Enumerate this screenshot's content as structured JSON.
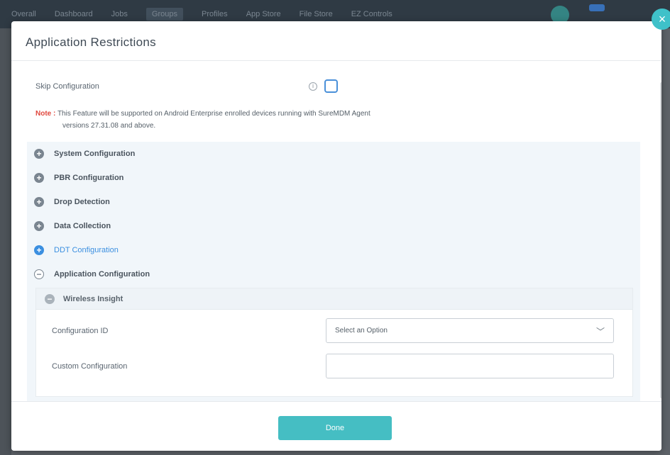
{
  "topnav": {
    "items": [
      "Overall",
      "Dashboard",
      "Jobs",
      "Groups",
      "Profiles",
      "App Store",
      "File Store",
      "EZ Controls"
    ]
  },
  "modal": {
    "title": "Application Restrictions",
    "close_icon": "×",
    "skip_configuration": {
      "label": "Skip Configuration",
      "info_icon": "i",
      "checked": false
    },
    "note": {
      "label": "Note :",
      "line1": "This Feature will be supported on Android Enterprise enrolled devices running with SureMDM Agent",
      "line2": "versions 27.31.08 and above."
    },
    "sections": [
      {
        "label": "System Configuration",
        "icon": "+",
        "state": "collapsed"
      },
      {
        "label": "PBR Configuration",
        "icon": "+",
        "state": "collapsed"
      },
      {
        "label": "Drop Detection",
        "icon": "+",
        "state": "collapsed"
      },
      {
        "label": "Data Collection",
        "icon": "+",
        "state": "collapsed"
      },
      {
        "label": "DDT Configuration",
        "icon": "+",
        "state": "highlighted"
      },
      {
        "label": "Application Configuration",
        "icon": "−",
        "state": "expanded"
      }
    ],
    "subpanel": {
      "title": "Wireless Insight",
      "icon": "−",
      "config_id": {
        "label": "Configuration ID",
        "selected": "Select an Option",
        "chevron": "﹀"
      },
      "custom_config": {
        "label": "Custom Configuration",
        "value": "",
        "placeholder": ""
      }
    },
    "done_label": "Done"
  },
  "colors": {
    "accent": "#45bec3",
    "link_blue": "#3b8fe0",
    "note_red": "#e0483e"
  }
}
